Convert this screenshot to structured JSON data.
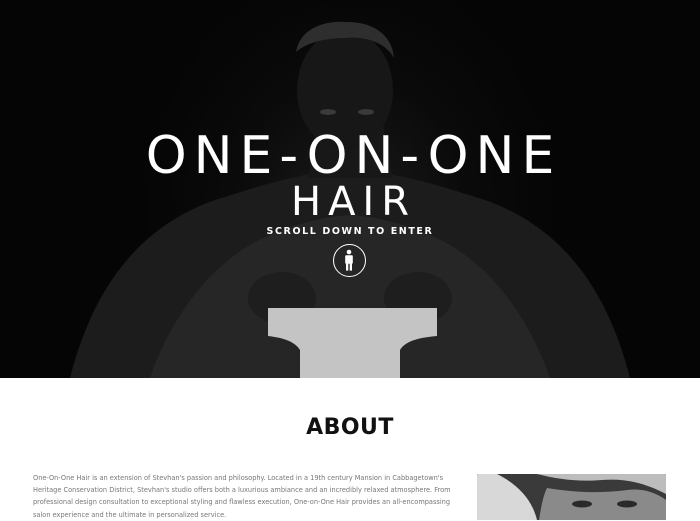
{
  "hero": {
    "title": "ONE-ON-ONE",
    "subtitle": "HAIR",
    "cta": "SCROLL DOWN TO ENTER",
    "enter_icon": "person-standing-icon",
    "background_image": "portrait-photo"
  },
  "about": {
    "heading": "ABOUT",
    "body": "One-On-One Hair is an extension of Stevhan's passion and philosophy. Located in a 19th century Mansion in Cabbagetown's Heritage Conservation District, Stevhan's studio offers both a luxurious ambiance and an incredibly relaxed atmosphere. From professional design consultation to exceptional styling and flawless execution, One-on-One Hair provides an all-encompassing salon experience and the ultimate in personalized service.",
    "photo": "portrait-photo"
  },
  "colors": {
    "hero_background": "#050505",
    "accent": "#ffffff",
    "body_text": "#777777",
    "heading": "#111111"
  }
}
